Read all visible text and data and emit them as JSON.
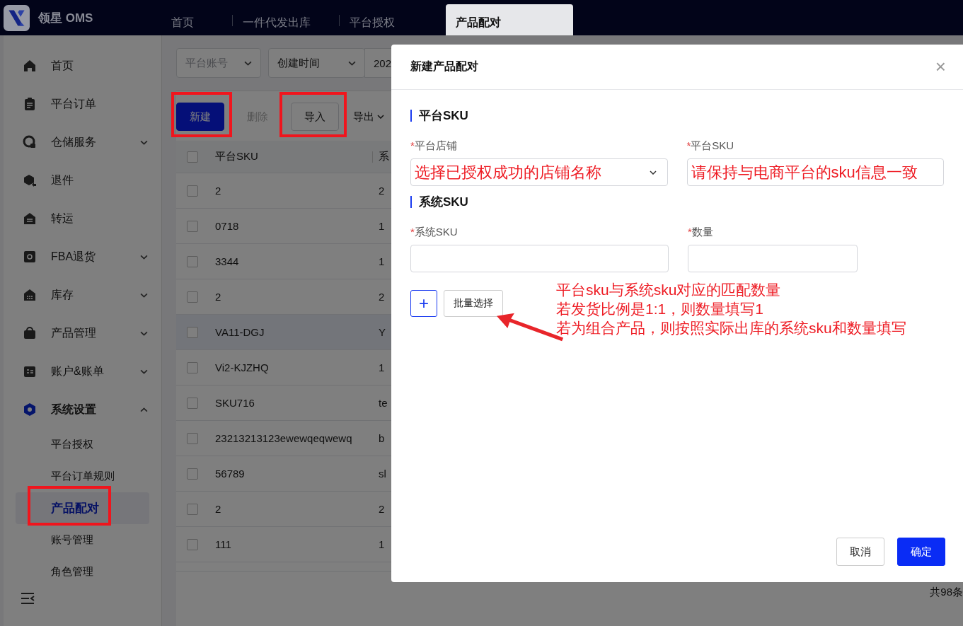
{
  "app": {
    "name": "领星 OMS"
  },
  "top_tabs": [
    {
      "label": "首页",
      "selected": false
    },
    {
      "label": "一件代发出库",
      "selected": false
    },
    {
      "label": "平台授权",
      "selected": false
    },
    {
      "label": "产品配对",
      "selected": true
    }
  ],
  "sidebar": {
    "items": [
      {
        "label": "首页",
        "kind": "link",
        "selected": false
      },
      {
        "label": "平台订单",
        "kind": "link",
        "selected": false
      },
      {
        "label": "仓储服务",
        "kind": "group",
        "expanded": false,
        "selected": false
      },
      {
        "label": "退件",
        "kind": "link",
        "selected": false
      },
      {
        "label": "转运",
        "kind": "link",
        "selected": false
      },
      {
        "label": "FBA退货",
        "kind": "group",
        "expanded": false,
        "selected": false
      },
      {
        "label": "库存",
        "kind": "group",
        "expanded": false,
        "selected": false
      },
      {
        "label": "产品管理",
        "kind": "group",
        "expanded": false,
        "selected": false
      },
      {
        "label": "账户&账单",
        "kind": "group",
        "expanded": false,
        "selected": false
      },
      {
        "label": "系统设置",
        "kind": "group",
        "expanded": true,
        "selected": true,
        "children": [
          {
            "label": "平台授权",
            "selected": false,
            "highlighted": false
          },
          {
            "label": "平台订单规则",
            "selected": false,
            "highlighted": false
          },
          {
            "label": "产品配对",
            "selected": true,
            "highlighted": true
          },
          {
            "label": "账号管理",
            "selected": false,
            "highlighted": false
          },
          {
            "label": "角色管理",
            "selected": false,
            "highlighted": false
          }
        ]
      }
    ]
  },
  "filters": [
    {
      "kind": "select",
      "placeholder": "平台账号"
    },
    {
      "kind": "select",
      "value": "创建时间"
    },
    {
      "kind": "date",
      "value": "202"
    }
  ],
  "toolbar": [
    {
      "label": "新建",
      "kind": "primary",
      "disabled": false,
      "highlighted": true
    },
    {
      "label": "删除",
      "kind": "plain",
      "disabled": true,
      "highlighted": false
    },
    {
      "label": "导入",
      "kind": "default",
      "disabled": false,
      "highlighted": true
    },
    {
      "label": "导出",
      "kind": "dropdown",
      "disabled": false,
      "highlighted": false
    }
  ],
  "table": {
    "header_checked": false,
    "columns": [
      "平台SKU",
      "系"
    ],
    "rows": [
      {
        "checked": false,
        "hovered": false,
        "cells": [
          "2",
          "2"
        ]
      },
      {
        "checked": false,
        "hovered": false,
        "cells": [
          "0718",
          "1"
        ]
      },
      {
        "checked": false,
        "hovered": false,
        "cells": [
          "3344",
          "1"
        ]
      },
      {
        "checked": false,
        "hovered": false,
        "cells": [
          "2",
          "2"
        ]
      },
      {
        "checked": false,
        "hovered": true,
        "cells": [
          "VA11-DGJ",
          "Y"
        ]
      },
      {
        "checked": false,
        "hovered": false,
        "cells": [
          "Vi2-KJZHQ",
          "1"
        ]
      },
      {
        "checked": false,
        "hovered": false,
        "cells": [
          "SKU716",
          "te"
        ]
      },
      {
        "checked": false,
        "hovered": false,
        "cells": [
          "23213213123ewewqeqwewq",
          "b"
        ]
      },
      {
        "checked": false,
        "hovered": false,
        "cells": [
          "56789",
          "sl"
        ]
      },
      {
        "checked": false,
        "hovered": false,
        "cells": [
          "2",
          "2"
        ]
      },
      {
        "checked": false,
        "hovered": false,
        "cells": [
          "111",
          "1"
        ]
      }
    ]
  },
  "pagination": {
    "total": "共98条"
  },
  "dialog": {
    "title": "新建产品配对",
    "close": "×",
    "sections": [
      {
        "title": "平台SKU",
        "fields": [
          {
            "label": "平台店铺",
            "required_mark": "*",
            "kind": "select",
            "value": "选择已授权成功的店铺名称"
          },
          {
            "label": "平台SKU",
            "required_mark": "*",
            "kind": "input",
            "value": "请保持与电商平台的sku信息一致"
          }
        ]
      },
      {
        "title": "系统SKU",
        "fields": [
          {
            "label": "系统SKU",
            "required_mark": "*",
            "kind": "input"
          },
          {
            "label": "数量",
            "required_mark": "*",
            "kind": "input"
          }
        ]
      }
    ],
    "add_button": "+",
    "batch_button": "批量选择",
    "annotation": [
      "平台sku与系统sku对应的匹配数量",
      "若发货比例是1:1，则数量填写1",
      "若为组合产品，则按照实际出库的系统sku和数量填写"
    ],
    "cancel": "取消",
    "confirm": "确定"
  }
}
